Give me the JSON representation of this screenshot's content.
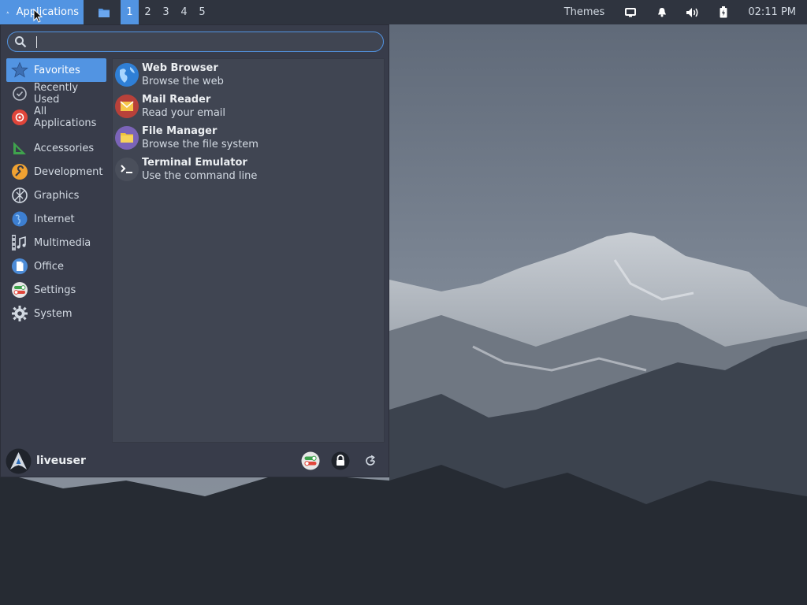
{
  "panel": {
    "apps_label": "Applications",
    "workspaces": [
      "1",
      "2",
      "3",
      "4",
      "5"
    ],
    "active_workspace": "1",
    "themes_label": "Themes",
    "clock": "02:11 PM",
    "accent_color": "#5294e2"
  },
  "menu": {
    "search": {
      "value": "",
      "placeholder": ""
    },
    "categories": [
      {
        "label": "Favorites",
        "icon": "favorites-star-icon",
        "active": true
      },
      {
        "label": "Recently Used",
        "icon": "recent-clock-icon"
      },
      {
        "label": "All Applications",
        "icon": "all-apps-icon"
      },
      {
        "label": "Accessories",
        "icon": "accessories-icon"
      },
      {
        "label": "Development",
        "icon": "development-icon"
      },
      {
        "label": "Graphics",
        "icon": "graphics-icon"
      },
      {
        "label": "Internet",
        "icon": "internet-icon"
      },
      {
        "label": "Multimedia",
        "icon": "multimedia-icon"
      },
      {
        "label": "Office",
        "icon": "office-icon"
      },
      {
        "label": "Settings",
        "icon": "settings-icon"
      },
      {
        "label": "System",
        "icon": "system-gear-icon"
      }
    ],
    "apps": [
      {
        "name": "Web Browser",
        "description": "Browse the web",
        "icon": "web-browser-icon"
      },
      {
        "name": "Mail Reader",
        "description": "Read your email",
        "icon": "mail-reader-icon"
      },
      {
        "name": "File Manager",
        "description": "Browse the file system",
        "icon": "file-manager-icon"
      },
      {
        "name": "Terminal Emulator",
        "description": "Use the command line",
        "icon": "terminal-icon"
      }
    ],
    "user": {
      "name": "liveuser"
    }
  }
}
